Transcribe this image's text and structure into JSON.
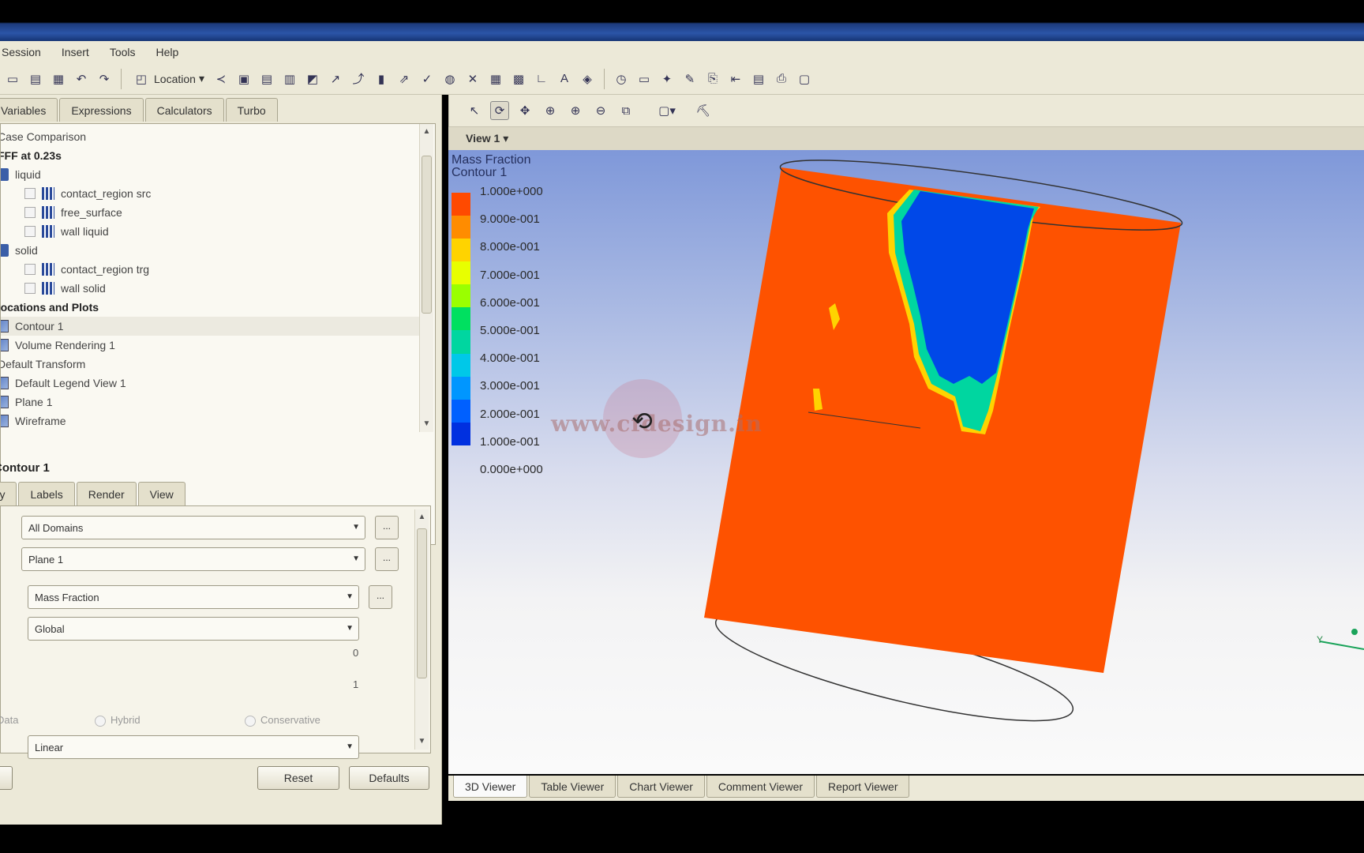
{
  "menu": [
    "Session",
    "Insert",
    "Tools",
    "Help"
  ],
  "toolbar": {
    "location_label": "Location",
    "icons": [
      "new-file-icon",
      "open-file-icon",
      "save-icon",
      "undo-icon",
      "redo-icon",
      "location-icon",
      "connect-icon",
      "plane-icon",
      "isosurface-icon",
      "volume-icon",
      "pointer-icon",
      "streamline-icon",
      "particle-track-icon",
      "chart-icon",
      "vector-icon",
      "contour-icon",
      "globe-icon",
      "clip-icon",
      "table-icon",
      "grid-icon",
      "axis-icon",
      "text-icon",
      "legend-icon",
      "clock-icon",
      "screen-icon",
      "probe-icon",
      "pen-icon",
      "export-icon",
      "import-icon",
      "comment-icon",
      "print-icon",
      "report-icon"
    ]
  },
  "left_tabs": [
    "Variables",
    "Expressions",
    "Calculators",
    "Turbo"
  ],
  "tree": {
    "case_comparison": "Case Comparison",
    "case_title": "FFF at 0.23s",
    "liquid_domain": "liquid",
    "liquid_items": [
      "contact_region src",
      "free_surface",
      "wall liquid"
    ],
    "solid_domain": "solid",
    "solid_items": [
      "contact_region trg",
      "wall solid"
    ],
    "user_section": "User Locations and Plots",
    "user_items": [
      "Contour 1",
      "Volume Rendering 1",
      "Default Transform",
      "Default Legend View 1",
      "Plane 1",
      "Wireframe"
    ]
  },
  "details": {
    "title": "Contour 1",
    "tabs": [
      "Geometry",
      "Labels",
      "Render",
      "View"
    ],
    "domains": "All Domains",
    "locations": "Plane 1",
    "variable": "Mass Fraction",
    "range": "Global",
    "min": "0",
    "max": "1",
    "boundary_data": "Data",
    "hybrid": "Hybrid",
    "conservative": "Conservative",
    "color_scale": "Linear",
    "reset": "Reset",
    "defaults": "Defaults"
  },
  "viewer": {
    "view_label": "View 1",
    "legend_title": "Mass Fraction",
    "legend_subtitle": "Contour 1",
    "legend_ticks": [
      "1.000e+000",
      "9.000e-001",
      "8.000e-001",
      "7.000e-001",
      "6.000e-001",
      "5.000e-001",
      "4.000e-001",
      "3.000e-001",
      "2.000e-001",
      "1.000e-001",
      "0.000e+000"
    ],
    "legend_colors": [
      "#ff4a00",
      "#ff8c00",
      "#ffd300",
      "#e8ff00",
      "#9aff00",
      "#00e060",
      "#00d6a0",
      "#00c8e8",
      "#0096ff",
      "#0060ff",
      "#0030e0"
    ],
    "watermark": "www.cfdesign.in",
    "axis_label": "Y",
    "colors": {
      "fluid": "#fe5200",
      "gas": "#0048e8"
    }
  },
  "viewer_tabs": [
    "3D Viewer",
    "Table Viewer",
    "Chart Viewer",
    "Comment Viewer",
    "Report Viewer"
  ]
}
